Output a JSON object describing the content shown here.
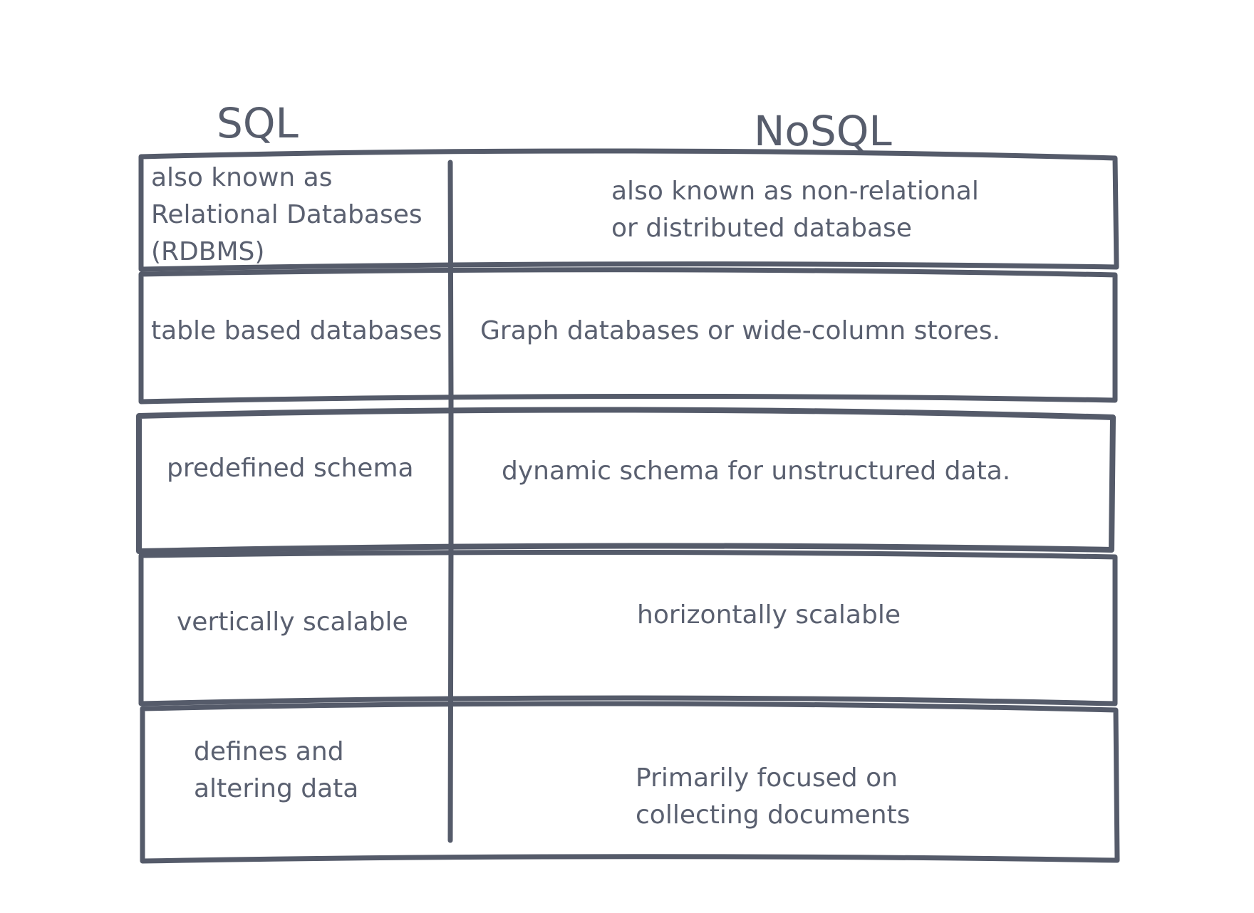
{
  "headers": {
    "sql": "SQL",
    "nosql": "NoSQL"
  },
  "rows": [
    {
      "sql": [
        "also known as",
        "Relational Databases",
        "(RDBMS)"
      ],
      "nosql": [
        "also known as non-relational",
        "or distributed database"
      ]
    },
    {
      "sql": [
        "table based databases"
      ],
      "nosql": [
        "Graph databases or wide-column stores."
      ]
    },
    {
      "sql": [
        "predefined schema"
      ],
      "nosql": [
        "dynamic schema for unstructured data."
      ]
    },
    {
      "sql": [
        "vertically scalable"
      ],
      "nosql": [
        "horizontally scalable"
      ]
    },
    {
      "sql": [
        "defines and",
        "altering data"
      ],
      "nosql": [
        "Primarily focused on",
        "collecting documents"
      ]
    }
  ],
  "colors": {
    "line": "#555b6a",
    "text": "#5a6070"
  }
}
